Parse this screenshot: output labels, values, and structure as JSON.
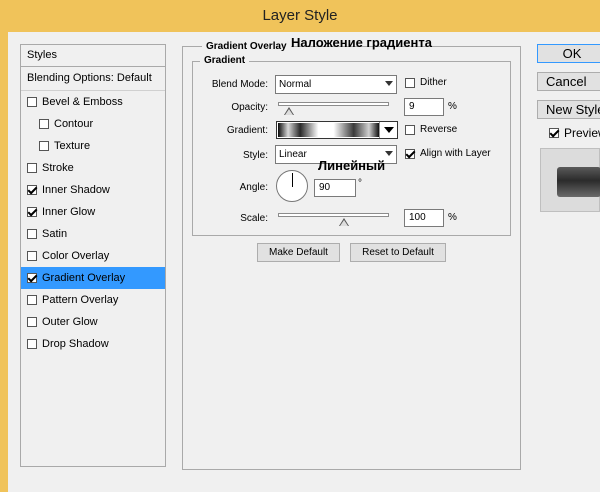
{
  "window": {
    "title": "Layer Style"
  },
  "styles_panel": {
    "header": "Styles",
    "blending_options": "Blending Options: Default",
    "items": [
      {
        "label": "Bevel & Emboss",
        "checked": false,
        "sub": false,
        "selected": false
      },
      {
        "label": "Contour",
        "checked": false,
        "sub": true,
        "selected": false
      },
      {
        "label": "Texture",
        "checked": false,
        "sub": true,
        "selected": false
      },
      {
        "label": "Stroke",
        "checked": false,
        "sub": false,
        "selected": false
      },
      {
        "label": "Inner Shadow",
        "checked": true,
        "sub": false,
        "selected": false
      },
      {
        "label": "Inner Glow",
        "checked": true,
        "sub": false,
        "selected": false
      },
      {
        "label": "Satin",
        "checked": false,
        "sub": false,
        "selected": false
      },
      {
        "label": "Color Overlay",
        "checked": false,
        "sub": false,
        "selected": false
      },
      {
        "label": "Gradient Overlay",
        "checked": true,
        "sub": false,
        "selected": true
      },
      {
        "label": "Pattern Overlay",
        "checked": false,
        "sub": false,
        "selected": false
      },
      {
        "label": "Outer Glow",
        "checked": false,
        "sub": false,
        "selected": false
      },
      {
        "label": "Drop Shadow",
        "checked": false,
        "sub": false,
        "selected": false
      }
    ]
  },
  "gradient_overlay": {
    "group_title": "Gradient Overlay",
    "annotation_title": "Наложение градиента",
    "sub_group_title": "Gradient",
    "blend_mode_label": "Blend Mode:",
    "blend_mode_value": "Normal",
    "dither_label": "Dither",
    "dither_checked": false,
    "opacity_label": "Opacity:",
    "opacity_value": "9",
    "opacity_level": 0.09,
    "percent": "%",
    "gradient_label": "Gradient:",
    "reverse_label": "Reverse",
    "reverse_checked": false,
    "style_label": "Style:",
    "style_value": "Linear",
    "style_annotation": "Линейный",
    "align_label": "Align with Layer",
    "align_checked": true,
    "angle_label": "Angle:",
    "angle_value": "90",
    "degree": "°",
    "scale_label": "Scale:",
    "scale_value": "100",
    "scale_level": 0.6,
    "make_default": "Make Default",
    "reset_default": "Reset to Default"
  },
  "right_panel": {
    "ok": "OK",
    "cancel": "Cancel",
    "new_style": "New Style",
    "preview_label": "Preview",
    "preview_checked": true
  },
  "colors": {
    "selected_item": "#3399ff",
    "titlebar": "#f0c35a"
  }
}
